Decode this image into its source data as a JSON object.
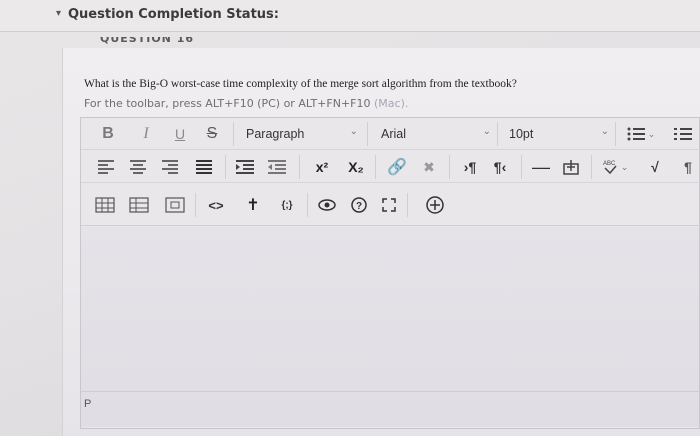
{
  "status": {
    "label": "Question Completion Status:",
    "chevron_icon": "chevron-down-icon"
  },
  "question": {
    "heading": "QUESTION 16",
    "text": "What is the Big-O worst-case time complexity of the merge sort algorithm from the textbook?",
    "hint_main": "For the toolbar, press ALT+F10 (PC) or ALT+FN+F10",
    "hint_mac": "(Mac)."
  },
  "toolbar": {
    "bold": "B",
    "italic": "I",
    "underline": "U",
    "strike": "S",
    "block_format": "Paragraph",
    "font_family": "Arial",
    "font_size": "10pt",
    "superscript": "x²",
    "subscript": "X₂",
    "ltr": "¶",
    "rtl": "¶",
    "code": "<>",
    "embed": "{;}"
  },
  "editor": {
    "path": "P"
  }
}
